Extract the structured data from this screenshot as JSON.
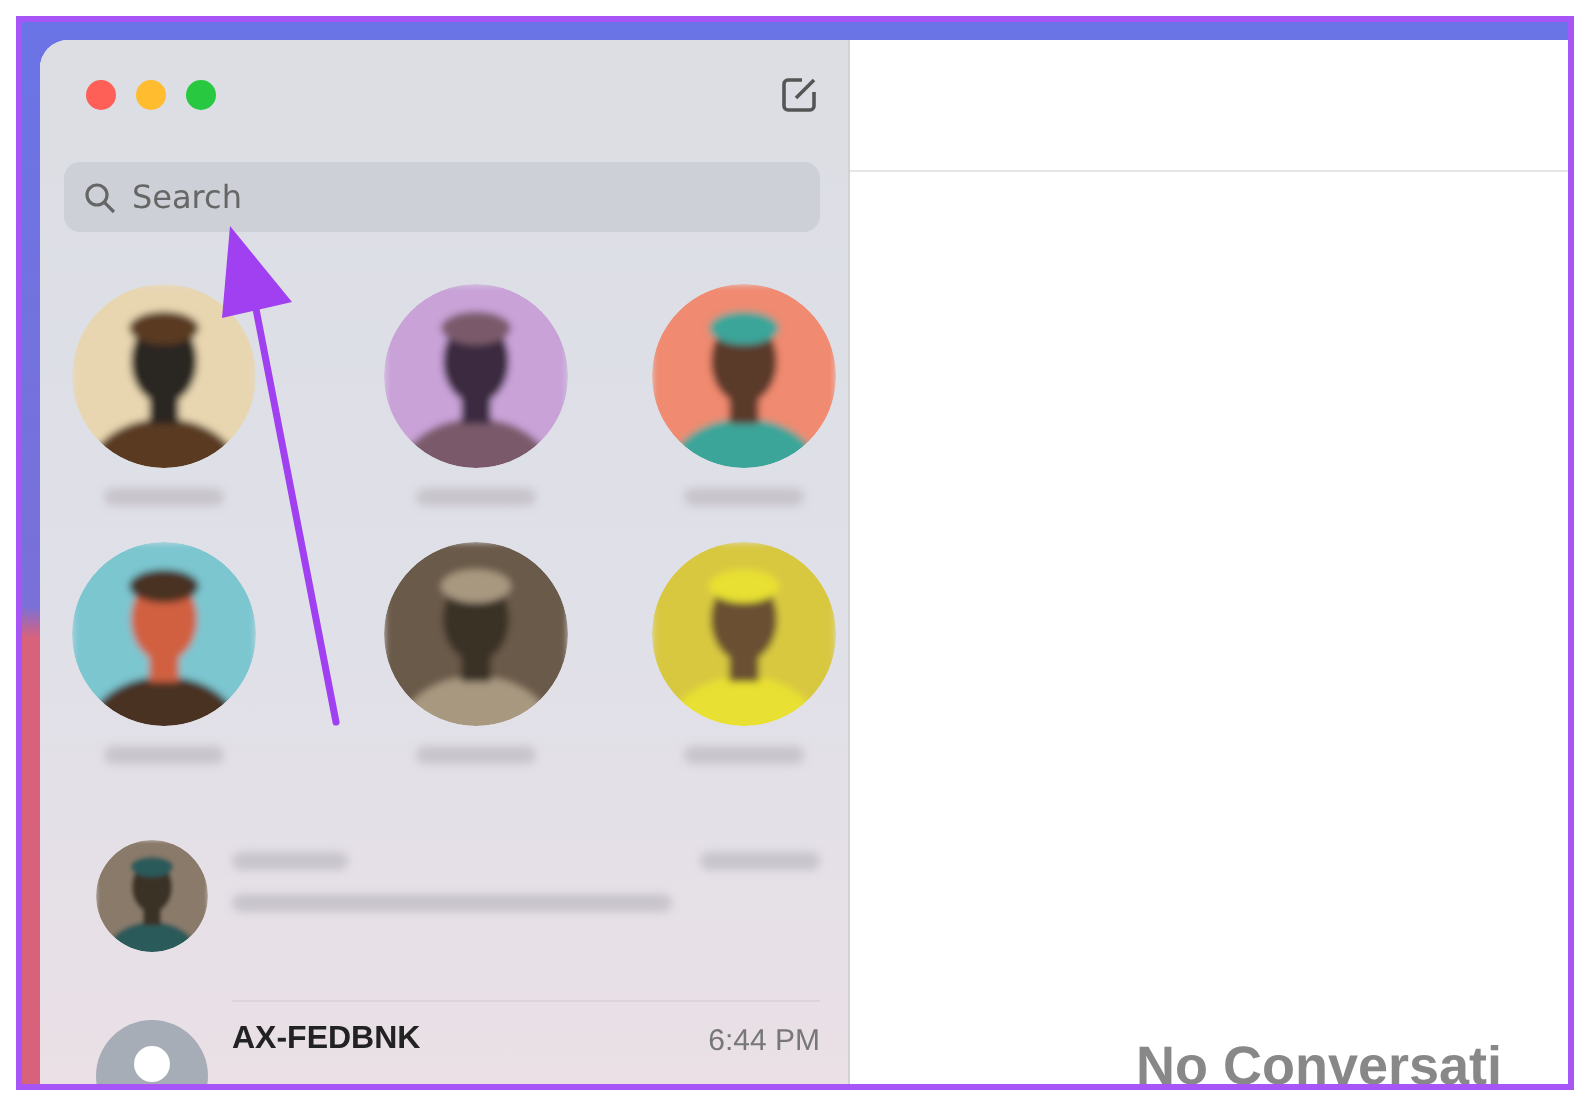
{
  "window": {
    "traffic_lights": [
      {
        "kind": "close"
      },
      {
        "kind": "minimize"
      },
      {
        "kind": "zoom"
      }
    ]
  },
  "search": {
    "placeholder": "Search"
  },
  "conversations": [
    {
      "kind": "blurred"
    },
    {
      "kind": "text",
      "name": "AX-FEDBNK",
      "time": "6:44 PM"
    }
  ],
  "empty_state": {
    "title": "No Conversati"
  },
  "annotation": {
    "kind": "arrow"
  }
}
